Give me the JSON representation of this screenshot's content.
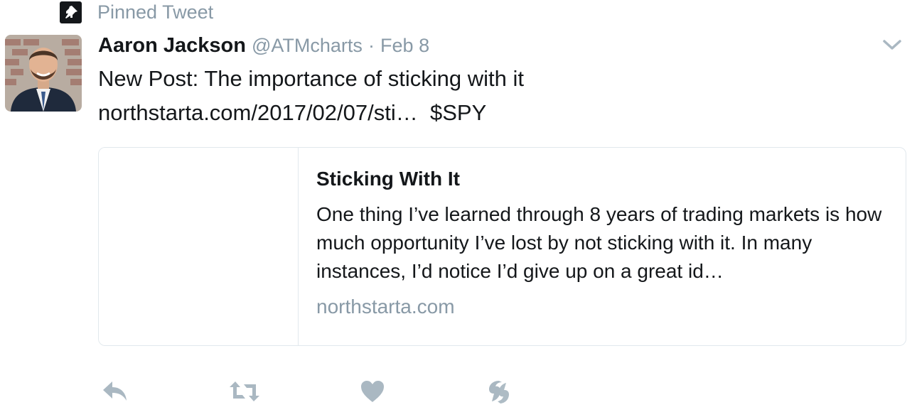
{
  "pinned": {
    "label": "Pinned Tweet",
    "icon": "pin-icon"
  },
  "tweet": {
    "author": {
      "name": "Aaron Jackson",
      "handle": "@ATMcharts",
      "avatar_icon": "avatar-photo"
    },
    "separator": "·",
    "date": "Feb 8",
    "text_line1": "New Post:  The importance of sticking with it",
    "link_text": "northstarta.com/2017/02/07/sti…",
    "cashtag": "$SPY",
    "menu_icon": "chevron-down-icon"
  },
  "card": {
    "title": "Sticking With It",
    "description": "One thing I’ve learned through 8 years of trading markets is how much opportunity I’ve lost by not sticking with it.  In many instances, I’d notice I’d give up on a great id…",
    "domain": "northstarta.com"
  },
  "actions": [
    {
      "name": "reply",
      "icon": "reply-icon"
    },
    {
      "name": "retweet",
      "icon": "retweet-icon"
    },
    {
      "name": "like",
      "icon": "heart-icon"
    },
    {
      "name": "moments",
      "icon": "moments-icon"
    }
  ],
  "colors": {
    "text": "#14171a",
    "secondary": "#8899a6",
    "border": "#e1e8ed",
    "icon": "#aab8c2"
  }
}
